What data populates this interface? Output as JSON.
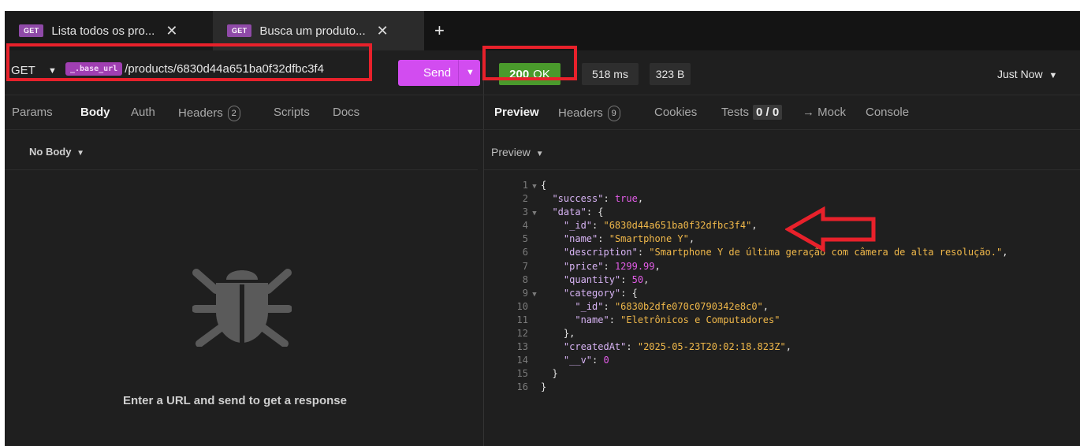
{
  "tabs": [
    {
      "method": "GET",
      "label": "Lista todos os pro...",
      "close": "✕"
    },
    {
      "method": "GET",
      "label": "Busca um produto...",
      "close": "✕"
    }
  ],
  "tab_add": "+",
  "request": {
    "method": "GET",
    "base_var": "_.base_url",
    "path": "/products/6830d44a651ba0f32dfbc3f4",
    "send_label": "Send"
  },
  "response": {
    "status_code": "200",
    "status_text": "OK",
    "time": "518 ms",
    "size": "323 B",
    "timestamp": "Just Now"
  },
  "request_tabs": {
    "params": "Params",
    "body": "Body",
    "auth": "Auth",
    "headers": "Headers",
    "headers_count": "2",
    "scripts": "Scripts",
    "docs": "Docs"
  },
  "response_tabs": {
    "preview": "Preview",
    "headers": "Headers",
    "headers_count": "9",
    "cookies": "Cookies",
    "tests": "Tests",
    "tests_count": "0 / 0",
    "mock": "→ Mock",
    "console": "Console"
  },
  "body_mode": "No Body",
  "preview_mode": "Preview",
  "empty_message": "Enter a URL and send to get a response",
  "colors": {
    "accent": "#d24cf0",
    "ok": "#4a9a2c",
    "highlight": "#e8212b"
  },
  "code_lines": [
    [
      {
        "t": "txt",
        "v": "{"
      }
    ],
    [
      {
        "t": "txt",
        "v": "  "
      },
      {
        "t": "k",
        "v": "\"success\""
      },
      {
        "t": "txt",
        "v": ": "
      },
      {
        "t": "b",
        "v": "true"
      },
      {
        "t": "txt",
        "v": ","
      }
    ],
    [
      {
        "t": "txt",
        "v": "  "
      },
      {
        "t": "k",
        "v": "\"data\""
      },
      {
        "t": "txt",
        "v": ": {"
      }
    ],
    [
      {
        "t": "txt",
        "v": "    "
      },
      {
        "t": "k",
        "v": "\"_id\""
      },
      {
        "t": "txt",
        "v": ": "
      },
      {
        "t": "s",
        "v": "\"6830d44a651ba0f32dfbc3f4\""
      },
      {
        "t": "txt",
        "v": ","
      }
    ],
    [
      {
        "t": "txt",
        "v": "    "
      },
      {
        "t": "k",
        "v": "\"name\""
      },
      {
        "t": "txt",
        "v": ": "
      },
      {
        "t": "s",
        "v": "\"Smartphone Y\""
      },
      {
        "t": "txt",
        "v": ","
      }
    ],
    [
      {
        "t": "txt",
        "v": "    "
      },
      {
        "t": "k",
        "v": "\"description\""
      },
      {
        "t": "txt",
        "v": ": "
      },
      {
        "t": "s",
        "v": "\"Smartphone Y de última geração com câmera de alta resolução.\""
      },
      {
        "t": "txt",
        "v": ","
      }
    ],
    [
      {
        "t": "txt",
        "v": "    "
      },
      {
        "t": "k",
        "v": "\"price\""
      },
      {
        "t": "txt",
        "v": ": "
      },
      {
        "t": "n",
        "v": "1299.99"
      },
      {
        "t": "txt",
        "v": ","
      }
    ],
    [
      {
        "t": "txt",
        "v": "    "
      },
      {
        "t": "k",
        "v": "\"quantity\""
      },
      {
        "t": "txt",
        "v": ": "
      },
      {
        "t": "n",
        "v": "50"
      },
      {
        "t": "txt",
        "v": ","
      }
    ],
    [
      {
        "t": "txt",
        "v": "    "
      },
      {
        "t": "k",
        "v": "\"category\""
      },
      {
        "t": "txt",
        "v": ": {"
      }
    ],
    [
      {
        "t": "txt",
        "v": "      "
      },
      {
        "t": "k",
        "v": "\"_id\""
      },
      {
        "t": "txt",
        "v": ": "
      },
      {
        "t": "s",
        "v": "\"6830b2dfe070c0790342e8c0\""
      },
      {
        "t": "txt",
        "v": ","
      }
    ],
    [
      {
        "t": "txt",
        "v": "      "
      },
      {
        "t": "k",
        "v": "\"name\""
      },
      {
        "t": "txt",
        "v": ": "
      },
      {
        "t": "s",
        "v": "\"Eletrônicos e Computadores\""
      }
    ],
    [
      {
        "t": "txt",
        "v": "    },"
      }
    ],
    [
      {
        "t": "txt",
        "v": "    "
      },
      {
        "t": "k",
        "v": "\"createdAt\""
      },
      {
        "t": "txt",
        "v": ": "
      },
      {
        "t": "s",
        "v": "\"2025-05-23T20:02:18.823Z\""
      },
      {
        "t": "txt",
        "v": ","
      }
    ],
    [
      {
        "t": "txt",
        "v": "    "
      },
      {
        "t": "k",
        "v": "\"__v\""
      },
      {
        "t": "txt",
        "v": ": "
      },
      {
        "t": "n",
        "v": "0"
      }
    ],
    [
      {
        "t": "txt",
        "v": "  }"
      }
    ],
    [
      {
        "t": "txt",
        "v": "}"
      }
    ]
  ],
  "foldable_lines": [
    1,
    3,
    9
  ]
}
